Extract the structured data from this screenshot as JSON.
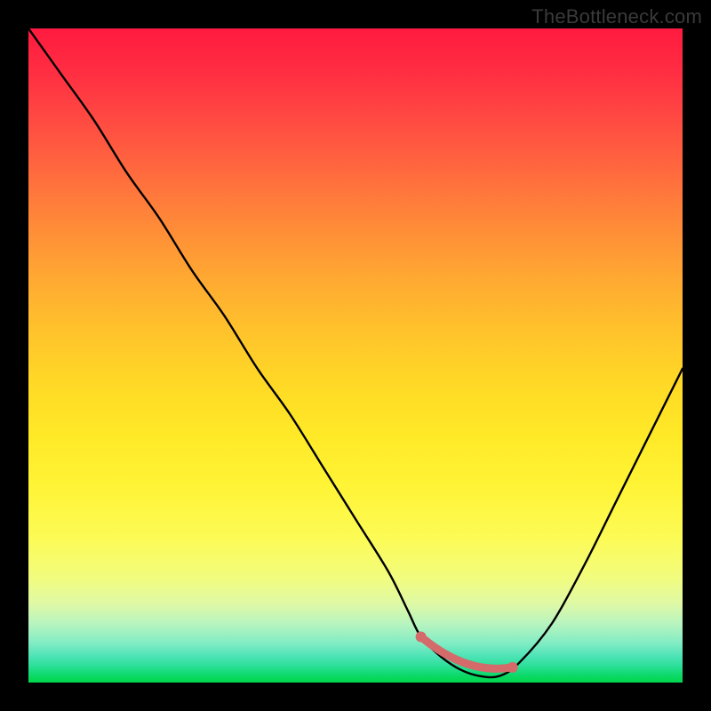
{
  "watermark": "TheBottleneck.com",
  "chart_data": {
    "type": "line",
    "title": "",
    "xlabel": "",
    "ylabel": "",
    "xlim": [
      0,
      100
    ],
    "ylim": [
      0,
      100
    ],
    "grid": false,
    "legend": false,
    "series": [
      {
        "name": "bottleneck-curve",
        "x": [
          0,
          5,
          10,
          15,
          20,
          25,
          30,
          35,
          40,
          45,
          50,
          55,
          58,
          60,
          63,
          66,
          69,
          72,
          75,
          80,
          85,
          90,
          95,
          100
        ],
        "values": [
          100,
          93,
          86,
          78,
          71,
          63,
          56,
          48,
          41,
          33,
          25,
          17,
          11,
          7,
          4,
          2,
          1,
          1,
          3,
          9,
          18,
          28,
          38,
          48
        ]
      }
    ],
    "flat_region": {
      "x_start": 60,
      "x_end": 74,
      "color": "#d46a6a"
    },
    "background_gradient": {
      "stops": [
        {
          "pos": 0,
          "color": "#ff1a3f"
        },
        {
          "pos": 50,
          "color": "#ffd826"
        },
        {
          "pos": 85,
          "color": "#f2fc7e"
        },
        {
          "pos": 100,
          "color": "#02d64e"
        }
      ]
    }
  }
}
